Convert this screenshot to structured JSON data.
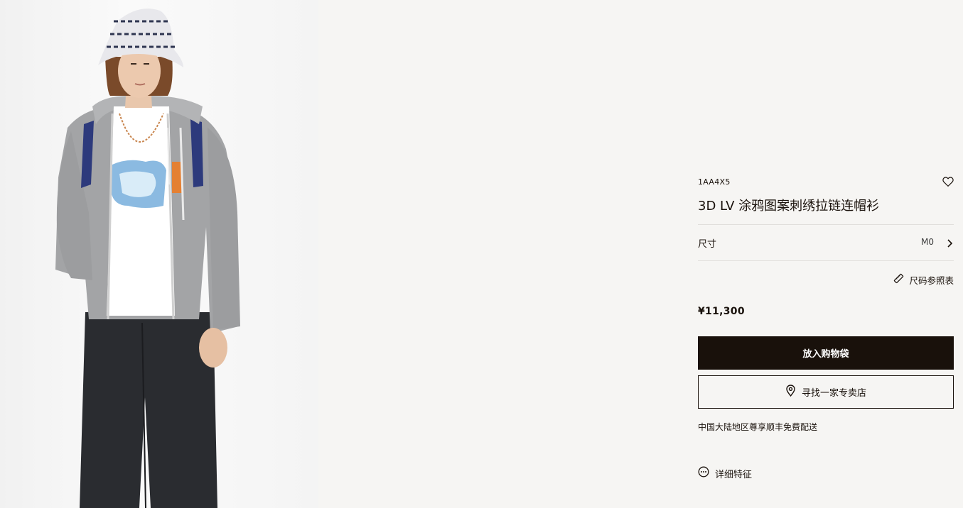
{
  "product": {
    "sku": "1AA4X5",
    "title": "3D LV 涂鸦图案刺绣拉链连帽衫",
    "price": "¥11,300",
    "size_label": "尺寸",
    "size_value": "M0",
    "size_guide": "尺码参照表",
    "add_to_bag": "放入购物袋",
    "find_store": "寻找一家专卖店",
    "shipping_note": "中国大陆地区尊享顺丰免费配送",
    "details": "详细特征"
  },
  "icons": {
    "wishlist": "heart-icon",
    "size_chevron": "chevron-right-icon",
    "size_guide": "ruler-icon",
    "store": "location-pin-icon",
    "details": "more-dots-icon"
  },
  "colors": {
    "background": "#f6f5f3",
    "primary_button": "#19110b",
    "text": "#19110b"
  }
}
